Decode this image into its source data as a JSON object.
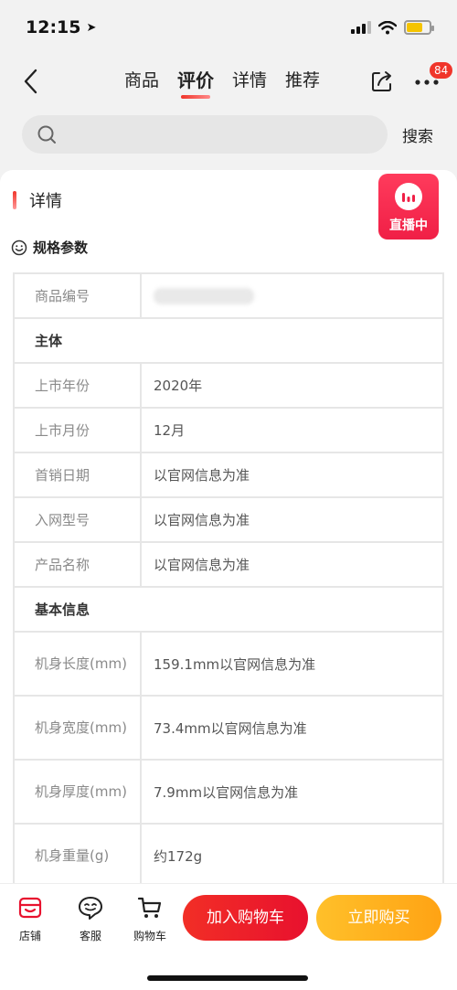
{
  "status": {
    "time": "12:15"
  },
  "nav": {
    "tabs": [
      "商品",
      "评价",
      "详情",
      "推荐"
    ],
    "active_tab": "评价",
    "more_badge": "84"
  },
  "search": {
    "placeholder": "",
    "button": "搜索"
  },
  "detail": {
    "section_title": "详情",
    "live_label": "直播中",
    "spec_title": "规格参数",
    "rows": [
      {
        "key": "商品编号",
        "value": ""
      },
      {
        "group": "主体"
      },
      {
        "key": "上市年份",
        "value": "2020年"
      },
      {
        "key": "上市月份",
        "value": "12月"
      },
      {
        "key": "首销日期",
        "value": "以官网信息为准"
      },
      {
        "key": "入网型号",
        "value": "以官网信息为准"
      },
      {
        "key": "产品名称",
        "value": "以官网信息为准"
      },
      {
        "group": "基本信息"
      },
      {
        "key": "机身长度(mm)",
        "value": "159.1mm以官网信息为准"
      },
      {
        "key": "机身宽度(mm)",
        "value": "73.4mm以官网信息为准"
      },
      {
        "key": "机身厚度(mm)",
        "value": "7.9mm以官网信息为准"
      },
      {
        "key": "机身重量(g)",
        "value": "约172g"
      }
    ]
  },
  "bottom": {
    "shop": "店铺",
    "service": "客服",
    "cart": "购物车",
    "add_to_cart": "加入购物车",
    "buy_now": "立即购买"
  },
  "colors": {
    "accent_red": "#f0352a",
    "buy_orange": "#ffa314",
    "live_pink": "#f01f46"
  }
}
